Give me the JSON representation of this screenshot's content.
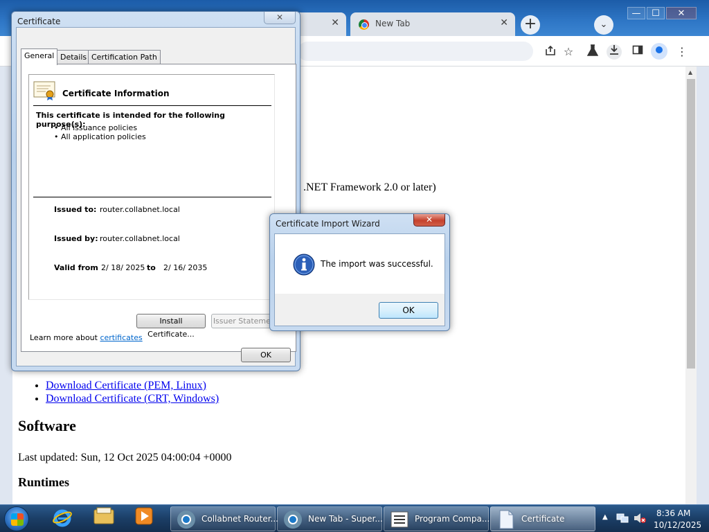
{
  "browser": {
    "tabs": [
      {
        "title": "",
        "close": "✕"
      },
      {
        "title": "New Tab",
        "close": "✕"
      }
    ],
    "new_tab": "+",
    "tab_search": "⌄",
    "window_controls": {
      "minimize": "—",
      "maximize": "☐",
      "close": "✕"
    },
    "toolbar_icons": [
      "share-icon",
      "bookmark-star-icon",
      "labs-icon",
      "download-icon",
      "side-panel-icon",
      "profile-avatar-icon",
      "menu-icon"
    ]
  },
  "page": {
    "net_framework_text": ".NET Framework 2.0 or later)",
    "downloads": [
      "Download Certificate (PEM, Linux)",
      "Download Certificate (CRT, Windows)"
    ],
    "software_heading": "Software",
    "last_updated": "Last updated: Sun, 12 Oct 2025 04:00:04 +0000",
    "runtimes_heading": "Runtimes"
  },
  "certificate_dialog": {
    "title": "Certificate",
    "close": "✕",
    "tabs": [
      "General",
      "Details",
      "Certification Path"
    ],
    "info_title": "Certificate Information",
    "purpose_heading": "This certificate is intended for the following purpose(s):",
    "purposes": [
      "• All issuance policies",
      "• All application policies"
    ],
    "issued_to_label": "Issued to:",
    "issued_to": "router.collabnet.local",
    "issued_by_label": "Issued by:",
    "issued_by": "router.collabnet.local",
    "valid_from_label": "Valid from",
    "valid_from": "2/ 18/ 2025",
    "to_label": "to",
    "valid_to": "2/ 16/ 2035",
    "install_button": "Install Certificate...",
    "issuer_statement_button": "Issuer Statement",
    "learn_more_prefix": "Learn more about ",
    "learn_more_link": "certificates",
    "ok_button": "OK"
  },
  "import_wizard": {
    "title": "Certificate Import Wizard",
    "close": "✕",
    "message": "The import was successful.",
    "ok_button": "OK"
  },
  "taskbar": {
    "tasks": [
      {
        "label": "Collabnet Router...",
        "icon": "chrome-icon"
      },
      {
        "label": "New Tab - Super...",
        "icon": "chrome-icon"
      },
      {
        "label": "Program Compa...",
        "icon": "list-window-icon"
      },
      {
        "label": "Certificate",
        "icon": "document-icon"
      }
    ],
    "time": "8:36 AM",
    "date": "10/12/2025"
  },
  "colors": {
    "link": "#0000ee",
    "accent": "#1a73e8",
    "close_red": "#c5422d"
  }
}
